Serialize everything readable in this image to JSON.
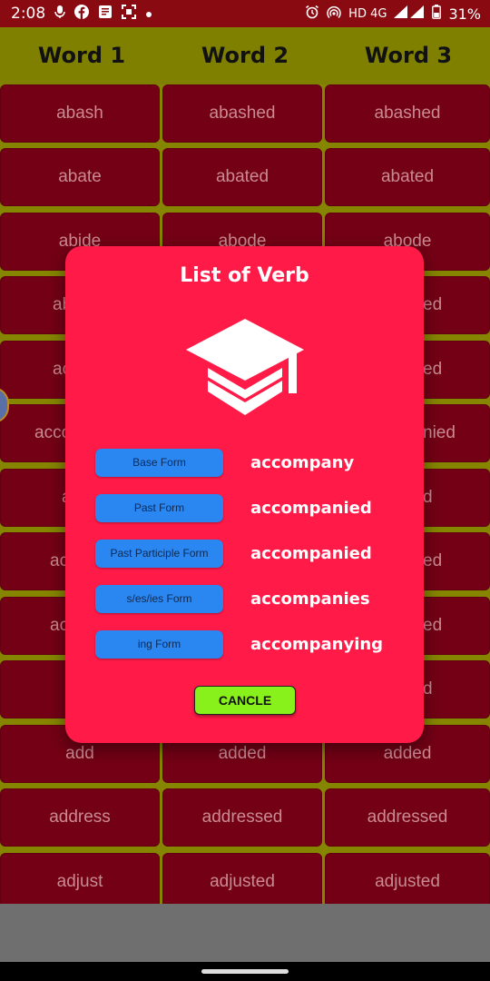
{
  "status_bar": {
    "time": "2:08",
    "network": "HD 4G",
    "battery": "31%",
    "icons": [
      "mic-icon",
      "facebook-icon",
      "document-icon",
      "scan-icon",
      "dot-icon",
      "alarm-icon",
      "hotspot-icon",
      "signal-icon",
      "battery-icon"
    ]
  },
  "header": {
    "columns": [
      "Word 1",
      "Word 2",
      "Word 3"
    ]
  },
  "rows": [
    [
      "abash",
      "abashed",
      "abashed"
    ],
    [
      "abate",
      "abated",
      "abated"
    ],
    [
      "abide",
      "abode",
      "abode"
    ],
    [
      "",
      "",
      ""
    ],
    [
      "",
      "",
      ""
    ],
    [
      "",
      "",
      ""
    ],
    [
      "",
      "",
      ""
    ],
    [
      "",
      "",
      ""
    ],
    [
      "",
      "",
      ""
    ],
    [
      "",
      "",
      ""
    ],
    [
      "add",
      "added",
      "added"
    ],
    [
      "address",
      "addressed",
      "addressed"
    ],
    [
      "adjust",
      "adjusted",
      "adjusted"
    ]
  ],
  "partial_visible": {
    "row3": [
      "ab",
      "ed"
    ],
    "row4": [
      "ac",
      "ed"
    ],
    "row5": [
      "acco",
      "nied"
    ],
    "row6": [
      "a",
      "d"
    ],
    "row7": [
      "ac",
      "ed"
    ],
    "row8": [
      "ac",
      "ed"
    ],
    "row9": [
      "",
      "d"
    ]
  },
  "dialog": {
    "title": "List of Verb",
    "icon": "graduation-cap-icon",
    "forms": [
      {
        "label": "Base Form",
        "value": "accompany"
      },
      {
        "label": "Past Form",
        "value": "accompanied"
      },
      {
        "label": "Past Participle Form",
        "value": "accompanied"
      },
      {
        "label": "s/es/ies Form",
        "value": "accompanies"
      },
      {
        "label": "ing Form",
        "value": "accompanying"
      }
    ],
    "cancel_label": "CANCLE"
  },
  "colors": {
    "header_bg": "#808000",
    "cell_bg": "#740015",
    "dialog_bg": "#ff1a47",
    "form_button": "#2a86f0",
    "cancel_button": "#88f01a"
  }
}
